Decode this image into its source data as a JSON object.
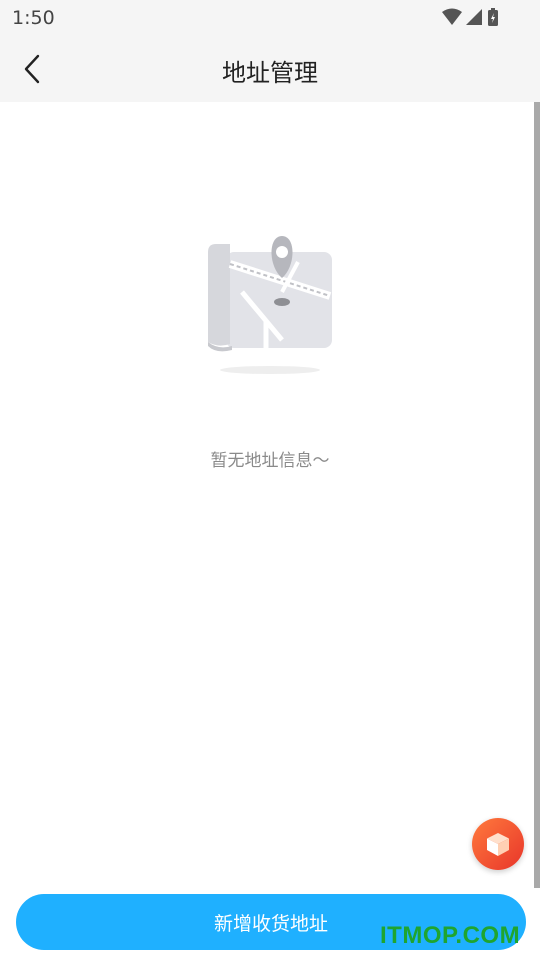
{
  "status_bar": {
    "time": "1:50",
    "icons": [
      "wifi-icon",
      "cellular-signal-icon",
      "battery-charging-icon"
    ]
  },
  "header": {
    "back_icon": "chevron-left-icon",
    "title": "地址管理"
  },
  "empty_state": {
    "illustration": "map-pin-icon",
    "message": "暂无地址信息～"
  },
  "floating_button": {
    "icon": "box-icon",
    "color": "#ef4a2e"
  },
  "footer": {
    "add_button_label": "新增收货地址",
    "accent_color": "#1fb0ff"
  },
  "watermark": "ITMOP.COM"
}
